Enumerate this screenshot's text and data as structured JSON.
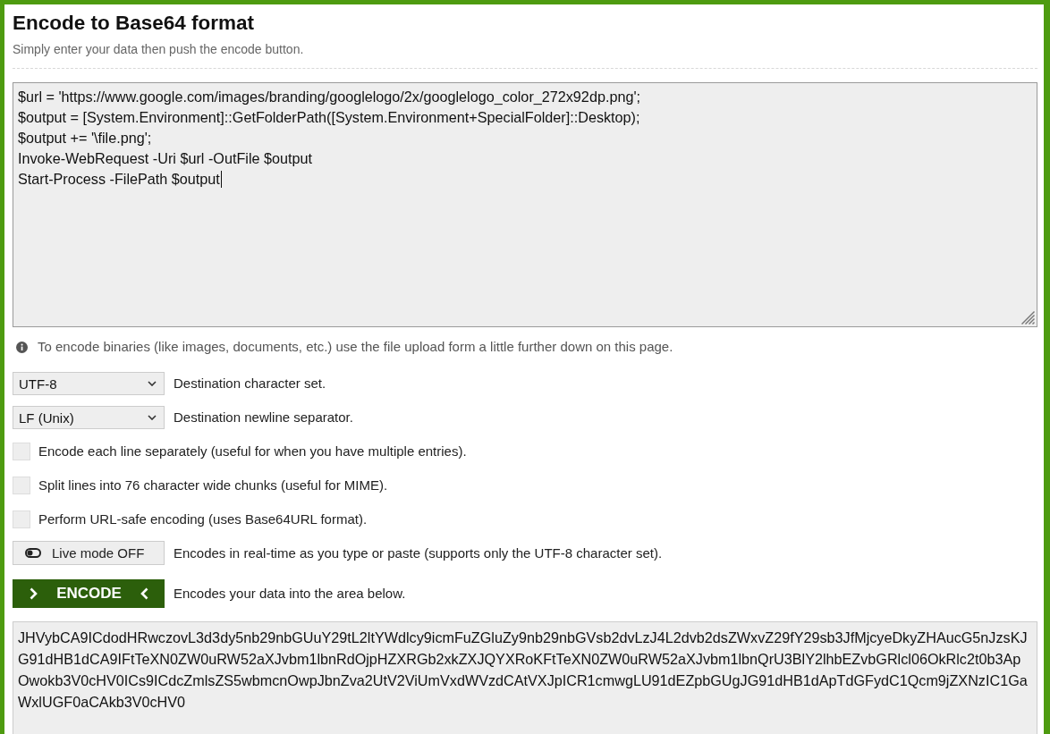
{
  "title": "Encode to Base64 format",
  "subtitle": "Simply enter your data then push the encode button.",
  "input": {
    "value": "$url = 'https://www.google.com/images/branding/googlelogo/2x/googlelogo_color_272x92dp.png';\n$output = [System.Environment]::GetFolderPath([System.Environment+SpecialFolder]::Desktop);\n$output += '\\file.png';\nInvoke-WebRequest -Uri $url -OutFile $output\nStart-Process -FilePath $output",
    "focused": true
  },
  "info_note": "To encode binaries (like images, documents, etc.) use the file upload form a little further down on this page.",
  "selects": [
    {
      "value": "UTF-8",
      "label": "Destination character set."
    },
    {
      "value": "LF (Unix)",
      "label": "Destination newline separator."
    }
  ],
  "options": [
    {
      "label": "Encode each line separately (useful for when you have multiple entries).",
      "checked": false
    },
    {
      "label": "Split lines into 76 character wide chunks (useful for MIME).",
      "checked": false
    },
    {
      "label": "Perform URL-safe encoding (uses Base64URL format).",
      "checked": false
    }
  ],
  "live_mode": {
    "label": "Live mode OFF",
    "on": false,
    "description": "Encodes in real-time as you type or paste (supports only the UTF-8 character set)."
  },
  "encode_button": {
    "label": "ENCODE",
    "description": "Encodes your data into the area below."
  },
  "output": {
    "value": "JHVybCA9ICdodHRwczovL3d3dy5nb29nbGUuY29tL2ltYWdlcy9icmFuZGluZy9nb29nbGVsb2dvLzJ4L2dvb2dsZWxvZ29fY29sb3JfMjcyeDkyZHAucG5nJzsKJG91dHB1dCA9IFtTeXN0ZW0uRW52aXJvbm1lbnRdOjpHZXRGb2xkZXJQYXRoKFtTeXN0ZW0uRW52aXJvbm1lbnQrU3BlY2lhbEZvbGRlcl06OkRlc2t0b3ApOwokb3V0cHV0ICs9ICdcZmlsZS5wbmcnOwpJbnZva2UtV2ViUmVxdWVzdCAtVXJpICR1cmwgLU91dEZpbGUgJG91dHB1dApTdGFydC1Qcm9jZXNzIC1GaWxlUGF0aCAkb3V0cHV0"
  }
}
